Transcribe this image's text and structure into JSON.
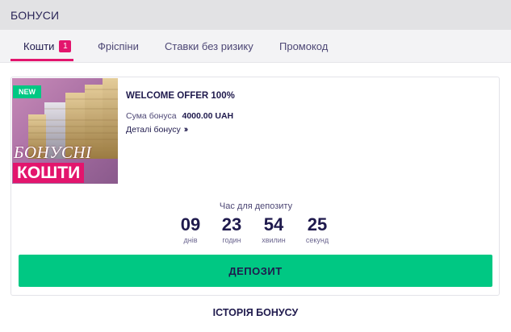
{
  "header": {
    "title": "БОНУСИ"
  },
  "tabs": [
    {
      "label": "Кошти",
      "badge": "1",
      "active": true
    },
    {
      "label": "Фріспіни"
    },
    {
      "label": "Ставки без ризику"
    },
    {
      "label": "Промокод"
    }
  ],
  "bonus_card": {
    "image": {
      "new_badge": "NEW",
      "line1": "БОНУСНІ",
      "line2": "КОШТИ"
    },
    "title": "WELCOME OFFER 100%",
    "sum_label": "Сума бонуса",
    "sum_value": "4000.00 UAH",
    "details_link": "Деталі бонусу",
    "timer": {
      "label": "Час для депозиту",
      "days": "09",
      "days_label": "днів",
      "hours": "23",
      "hours_label": "годин",
      "minutes": "54",
      "minutes_label": "хвилин",
      "seconds": "25",
      "seconds_label": "секунд"
    },
    "deposit_button": "ДЕПОЗИТ"
  },
  "history_link": "ІСТОРІЯ БОНУСУ",
  "colors": {
    "accent_pink": "#e3156d",
    "accent_green": "#00c883",
    "text_dark": "#1f1a4d"
  }
}
